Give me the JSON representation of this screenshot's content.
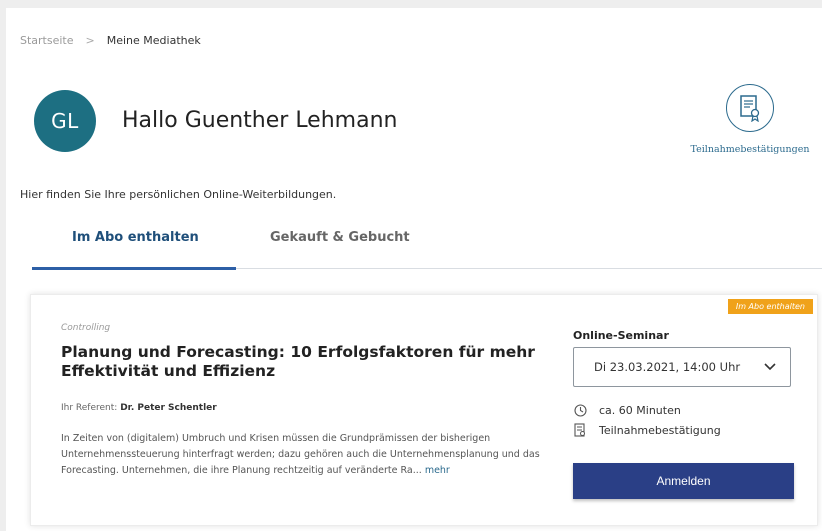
{
  "breadcrumb": {
    "home": "Startseite",
    "separator": ">",
    "current": "Meine Mediathek"
  },
  "user": {
    "initials": "GL",
    "greeting": "Hallo Guenther Lehmann"
  },
  "certificates": {
    "label": "Teilnahmebestätigungen",
    "icon": "certificate-icon"
  },
  "intro": "Hier finden Sie Ihre persönlichen Online-Weiterbildungen.",
  "tabs": [
    {
      "label": "Im Abo enthalten",
      "active": true
    },
    {
      "label": "Gekauft & Gebucht",
      "active": false
    }
  ],
  "course": {
    "badge": "Im Abo enthalten",
    "category": "Controlling",
    "title": "Planung und Forecasting: 10 Erfolgsfaktoren für mehr Effektivität und Effizienz",
    "referent_label": "Ihr Referent:",
    "referent_name": "Dr. Peter Schentler",
    "description": "In Zeiten von (digitalem) Umbruch und Krisen müssen die Grundprämissen der bisherigen Unternehmenssteuerung hinterfragt werden; dazu gehören auch die Unternehmensplanung und das Forecasting. Unternehmen, die ihre Planung rechtzeitig auf veränderte Ra...",
    "more": "mehr",
    "type_label": "Online-Seminar",
    "date": "Di 23.03.2021, 14:00 Uhr",
    "duration": "ca. 60 Minuten",
    "certificate": "Teilnahmebestätigung",
    "cta": "Anmelden"
  },
  "colors": {
    "avatar": "#1d6f82",
    "accent": "#2d5fa6",
    "badge": "#f0a21a",
    "button": "#2a3f86"
  }
}
